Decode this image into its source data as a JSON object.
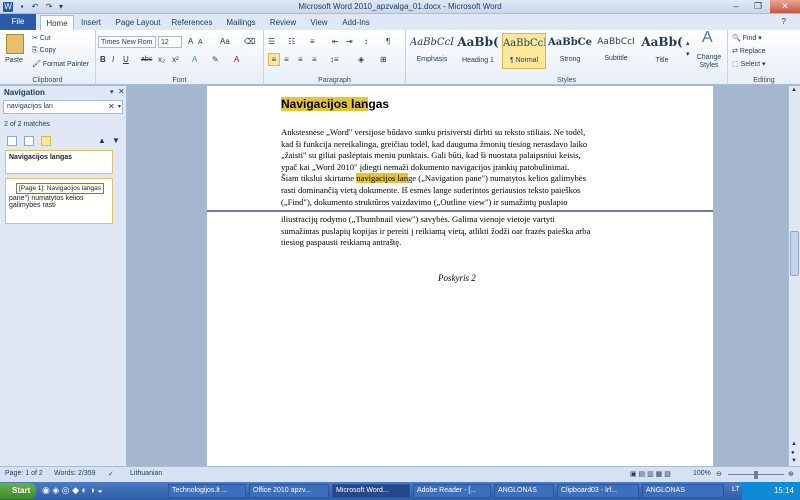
{
  "window": {
    "title": "Microsoft Word 2010_apzvalga_01.docx - Microsoft Word"
  },
  "tabs": [
    "File",
    "Home",
    "Insert",
    "Page Layout",
    "References",
    "Mailings",
    "Review",
    "View",
    "Add-Ins"
  ],
  "ribbon": {
    "clipboard": {
      "paste": "Paste",
      "cut": "Cut",
      "copy": "Copy",
      "format_painter": "Format Painter",
      "label": "Clipboard"
    },
    "font": {
      "name": "Times New Rom",
      "size": "12",
      "label": "Font"
    },
    "paragraph": {
      "label": "Paragraph"
    },
    "styles": {
      "items": [
        {
          "sample": "AaBbCcI",
          "name": "Emphasis"
        },
        {
          "sample": "AaBb(",
          "name": "Heading 1"
        },
        {
          "sample": "AaBbCcI",
          "name": "¶ Normal"
        },
        {
          "sample": "AaBbCel",
          "name": "Strong"
        },
        {
          "sample": "AaBbCcI",
          "name": "Subtitle"
        },
        {
          "sample": "AaBb(",
          "name": "Title"
        }
      ],
      "change_styles": "Change Styles",
      "label": "Styles"
    },
    "editing": {
      "find": "Find",
      "replace": "Replace",
      "select": "Select",
      "label": "Editing"
    }
  },
  "navigation": {
    "title": "Navigation",
    "search_value": "navigacijos lan",
    "matches": "2 of 2 matches",
    "result1": "Navigacijos langas",
    "result2": "pane\") numatytos kelios galimybės rasti",
    "tooltip": "[Page 1]: Navigacijos langas"
  },
  "document": {
    "heading_hl": "Navigacijos lan",
    "heading_rest": "gas",
    "p1_lines": [
      "Ankstesnėse „Word\" versijose būdavo sunku prisiversti dirbti su teksto stiliais. Ne todėl,",
      "kad ši funkcija nereikalinga, greičiau todėl, kad dauguma žmonių tiesiog nerasdavo laiko",
      "„žaisti\" su giliai paslėptais meniu punktais. Gali būti, kad ši nuostata palaipsniui keisis,",
      "ypač kai „Word 2010\" įdiegti nemaži dokumento navigacijos įrankių patobulinimai."
    ],
    "p2_pre": "Šiam tikslui skirtame ",
    "p2_hl": "navigacijos lan",
    "p2_post": "ge („Navigation pane\") numatytos kelios galimybės",
    "p2_lines": [
      "rasti dominančią vietą dokumente. Iš esmės lange suderintos geriausios teksto paieškos",
      "(„Find\"), dokumento struktūros vaizdavimo („Outline view\") ir sumažintų puslapio"
    ],
    "p3_lines": [
      "iliustracijų rodymo („Thumbnail view\") savybės. Galima vienoje vietoje vartyti",
      "sumažintas puslapių kopijas ir pereiti į reikiamą vietą, atlikti žodži oar frazės paieška arba",
      "tiesiog paspausti reikiamą antraštę."
    ],
    "caption": "Poskyris 2"
  },
  "statusbar": {
    "page": "Page: 1 of 2",
    "words": "Words: 2/359",
    "language": "Lithuanian",
    "zoom": "100%"
  },
  "taskbar": {
    "start": "Start",
    "items": [
      "Technologijos.lt ...",
      "Office 2010 apzv...",
      "Microsoft Word...",
      "Adobe Reader - [...",
      "ANGLONAS",
      "Clipboard03 - Irf...",
      "ANGLONAS"
    ],
    "lang": "LT",
    "clock": "15:14"
  }
}
